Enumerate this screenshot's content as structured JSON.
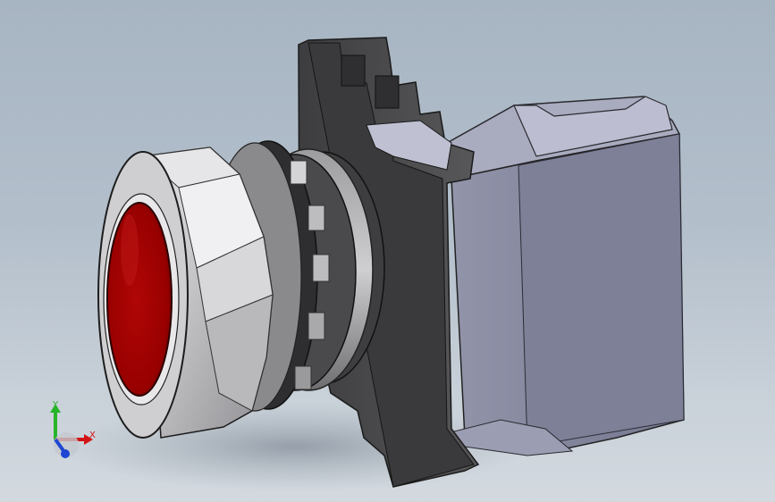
{
  "viewport": {
    "background_top": "#a7b4c2",
    "background_bottom": "#d3d9df"
  },
  "model": {
    "button_color": "#a00000",
    "bezel_color": "#c9c9cb",
    "holder_color": "#4a4a4c",
    "contact_block_color": "#7d7f96"
  },
  "triad": {
    "x_label": "X",
    "y_label": "Y",
    "x_color": "#d21414",
    "y_color": "#28b428",
    "z_color": "#1e46d2"
  }
}
